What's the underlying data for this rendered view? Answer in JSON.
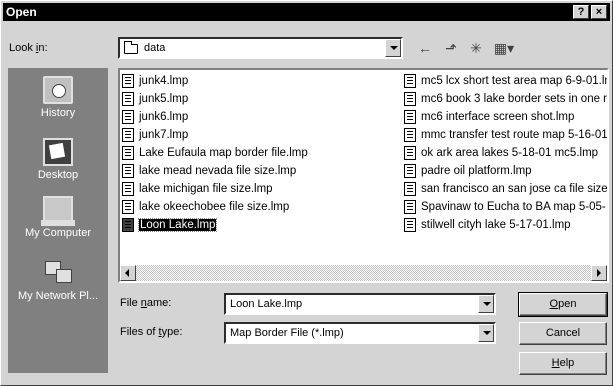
{
  "title": "Open",
  "titlebar": {
    "help": "?",
    "close": "×"
  },
  "look_in": {
    "label_pre": "Look ",
    "label_key": "i",
    "label_post": "n:",
    "value": "data"
  },
  "toolbar": {
    "back": "←",
    "up": "⬏",
    "new_folder": "✳",
    "views": "▦▾"
  },
  "places": [
    {
      "label": "History",
      "icon": "history-icon"
    },
    {
      "label": "Desktop",
      "icon": "desktop-icon"
    },
    {
      "label": "My Computer",
      "icon": "computer-icon"
    },
    {
      "label": "My Network Pl...",
      "icon": "network-icon"
    }
  ],
  "files_col1": [
    "junk4.lmp",
    "junk5.lmp",
    "junk6.lmp",
    "junk7.lmp",
    "Lake Eufaula map border file.lmp",
    "lake mead nevada file size.lmp",
    "lake michigan file size.lmp",
    "lake okeechobee file size.lmp",
    "Loon Lake.lmp"
  ],
  "files_col2": [
    "mc5 lcx short test area map 6-9-01.lm",
    "mc6 book 3 lake border sets in one r",
    "mc6 interface screen shot.lmp",
    "mmc transfer test route map 5-16-01.",
    "ok ark area lakes 5-18-01 mc5.lmp",
    "padre oil platform.lmp",
    "san francisco an san jose ca file size",
    "Spavinaw to Eucha to BA map 5-05-",
    "stilwell cityh lake 5-17-01.lmp"
  ],
  "selected_file": "Loon Lake.lmp",
  "file_name": {
    "label_pre": "File ",
    "label_key": "n",
    "label_post": "ame:",
    "value": "Loon Lake.lmp"
  },
  "file_type": {
    "label_pre": "Files of ",
    "label_key": "t",
    "label_post": "ype:",
    "value": "Map Border File (*.lmp)"
  },
  "buttons": {
    "open_key": "O",
    "open_rest": "pen",
    "cancel": "Cancel",
    "help_key": "H",
    "help_rest": "elp"
  }
}
